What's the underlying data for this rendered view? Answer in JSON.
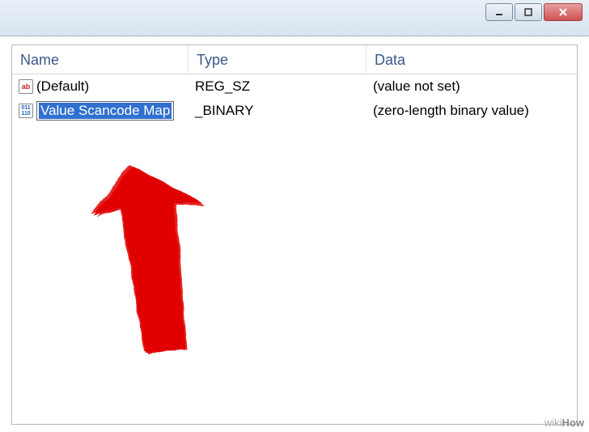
{
  "columns": {
    "name": "Name",
    "type": "Type",
    "data": "Data"
  },
  "rows": [
    {
      "icon": "string-icon",
      "iconText": "ab",
      "name": "(Default)",
      "type": "REG_SZ",
      "data": "(value not set)"
    },
    {
      "icon": "binary-icon",
      "iconText": "01\n10",
      "name": "Value Scancode Map",
      "type": "_BINARY",
      "data": "(zero-length binary value)"
    }
  ],
  "watermark": {
    "prefix": "wiki",
    "suffix": "How"
  },
  "annotation": {
    "color": "#e00000"
  }
}
